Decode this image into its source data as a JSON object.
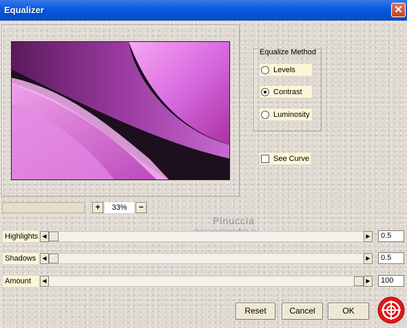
{
  "window": {
    "title": "Equalizer",
    "close_glyph": "✕"
  },
  "equalize_method": {
    "title": "Equalize Method",
    "options": [
      {
        "label": "Levels",
        "selected": false
      },
      {
        "label": "Contrast",
        "selected": true
      },
      {
        "label": "Luminosity",
        "selected": false
      }
    ]
  },
  "see_curve": {
    "label": "See Curve",
    "checked": false
  },
  "zoom": {
    "plus": "+",
    "minus": "−",
    "value": "33%"
  },
  "watermark": {
    "name": "Pinuccia",
    "url": "www.mariisgrafica.eu"
  },
  "sliders": [
    {
      "label": "Highlights",
      "value": "0.5",
      "fraction": 0.0
    },
    {
      "label": "Shadows",
      "value": "0.5",
      "fraction": 0.0
    },
    {
      "label": "Amount",
      "value": "100",
      "fraction": 1.0
    }
  ],
  "buttons": {
    "reset": "Reset",
    "cancel": "Cancel",
    "ok": "OK"
  },
  "icons": {
    "close": "close-icon",
    "help": "lifebuoy-help-icon",
    "left_arrow": "arrow-left-icon",
    "right_arrow": "arrow-right-icon"
  },
  "colors": {
    "titlebar": "#0a5de0",
    "label_bg": "#fbf6d6",
    "preview_pink": "#e080e8",
    "preview_dark": "#1c0f1e",
    "help_red": "#e01818"
  }
}
